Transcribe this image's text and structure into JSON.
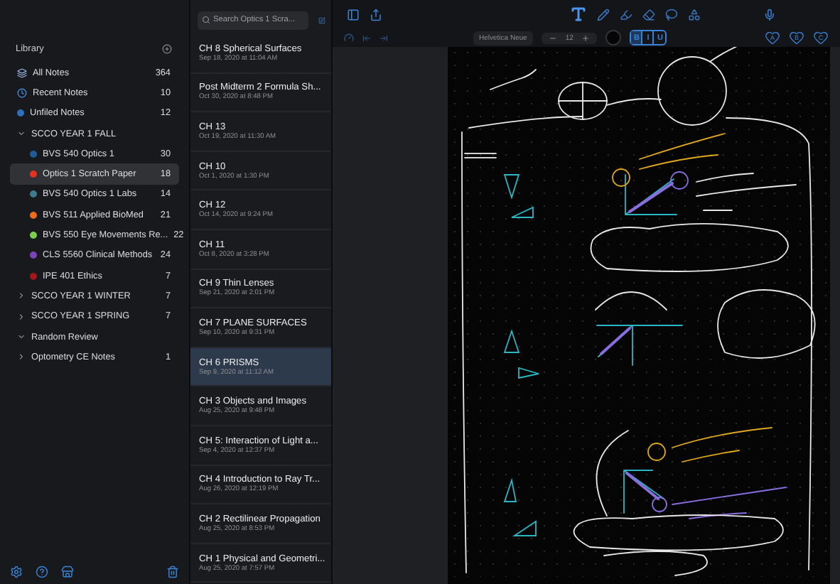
{
  "sidebar": {
    "title": "Library",
    "items": [
      {
        "kind": "all",
        "label": "All Notes",
        "count": "364",
        "selected": false
      },
      {
        "kind": "recent",
        "label": "Recent Notes",
        "count": "10",
        "selected": false
      },
      {
        "kind": "unfiled",
        "label": "Unfiled Notes",
        "count": "12",
        "selected": false
      },
      {
        "kind": "folder",
        "label": "SCCO YEAR 1 FALL",
        "expanded": true,
        "selected": false,
        "children": [
          {
            "kind": "notebook",
            "label": "BVS 540 Optics 1",
            "count": "30",
            "color": "#1f5c99",
            "selected": false
          },
          {
            "kind": "notebook",
            "label": "Optics 1 Scratch Paper",
            "count": "18",
            "color": "#e0321f",
            "selected": true
          },
          {
            "kind": "notebook",
            "label": "BVS 540 Optics 1 Labs",
            "count": "14",
            "color": "#3d7a8c",
            "selected": false
          },
          {
            "kind": "notebook",
            "label": "BVS 511 Applied BioMed",
            "count": "21",
            "color": "#ec6a1e",
            "selected": false
          },
          {
            "kind": "notebook",
            "label": "BVS 550 Eye Movements Re...",
            "count": "22",
            "color": "#7ccf4e",
            "selected": false
          },
          {
            "kind": "notebook",
            "label": "CLS 5560 Clinical Methods",
            "count": "24",
            "color": "#7a45b8",
            "selected": false
          },
          {
            "kind": "notebook",
            "label": "IPE 401 Ethics",
            "count": "7",
            "color": "#a3161a",
            "selected": false
          }
        ]
      },
      {
        "kind": "folder",
        "label": "SCCO YEAR 1 WINTER",
        "count": "7",
        "expanded": false,
        "selected": false
      },
      {
        "kind": "folder",
        "label": "SCCO YEAR 1 SPRING",
        "count": "7",
        "expanded": false,
        "selected": false
      },
      {
        "kind": "folder",
        "label": "Random Review",
        "expanded": true,
        "selected": false
      },
      {
        "kind": "folder",
        "label": "Optometry CE Notes",
        "count": "1",
        "expanded": false,
        "selected": false
      }
    ]
  },
  "notes": {
    "search": {
      "placeholder": "Search Optics 1 Scra..."
    },
    "items": [
      {
        "title": "CH 8 Spherical Surfaces",
        "date": "Sep 18, 2020 at 11:04 AM",
        "selected": false
      },
      {
        "title": "Post Midterm 2 Formula Sh...",
        "date": "Oct 30, 2020 at 8:48 PM",
        "selected": false
      },
      {
        "title": "CH 13",
        "date": "Oct 19, 2020 at 11:30 AM",
        "selected": false
      },
      {
        "title": "CH 10",
        "date": "Oct 1, 2020 at 1:30 PM",
        "selected": false
      },
      {
        "title": "CH 12",
        "date": "Oct 14, 2020 at 9:24 PM",
        "selected": false
      },
      {
        "title": "CH 11",
        "date": "Oct 8, 2020 at 3:28 PM",
        "selected": false
      },
      {
        "title": "CH 9 Thin Lenses",
        "date": "Sep 21, 2020 at 2:01 PM",
        "selected": false
      },
      {
        "title": "CH 7 PLANE SURFACES",
        "date": "Sep 10, 2020 at 9:31 PM",
        "selected": false
      },
      {
        "title": "CH 6 PRISMS",
        "date": "Sep 9, 2020 at 11:12 AM",
        "selected": true
      },
      {
        "title": "CH 3 Objects and Images",
        "date": "Aug 25, 2020 at 9:48 PM",
        "selected": false
      },
      {
        "title": "CH 5: Interaction of Light a...",
        "date": "Sep 4, 2020 at 12:37 PM",
        "selected": false
      },
      {
        "title": "CH 4 Introduction to Ray Tr...",
        "date": "Aug 26, 2020 at 12:19 PM",
        "selected": false
      },
      {
        "title": "CH 2 Rectilinear Propagation",
        "date": "Aug 25, 2020 at 8:53 PM",
        "selected": false
      },
      {
        "title": "CH 1 Physical and Geometri...",
        "date": "Aug 25, 2020 at 7:57 PM",
        "selected": false
      }
    ]
  },
  "editor": {
    "tools": [
      {
        "kind": "text",
        "selected": true
      },
      {
        "kind": "pen",
        "selected": false
      },
      {
        "kind": "highlighter",
        "selected": false
      },
      {
        "kind": "eraser",
        "selected": false
      },
      {
        "kind": "lasso",
        "selected": false
      },
      {
        "kind": "shapes",
        "selected": false
      }
    ],
    "font": "Helvetica Neue",
    "font_size": "12",
    "format": [
      {
        "label": "B",
        "selected": true
      },
      {
        "label": "I",
        "selected": false
      },
      {
        "label": "U",
        "selected": false
      }
    ],
    "highlights": [
      "A",
      "B",
      "C"
    ]
  }
}
